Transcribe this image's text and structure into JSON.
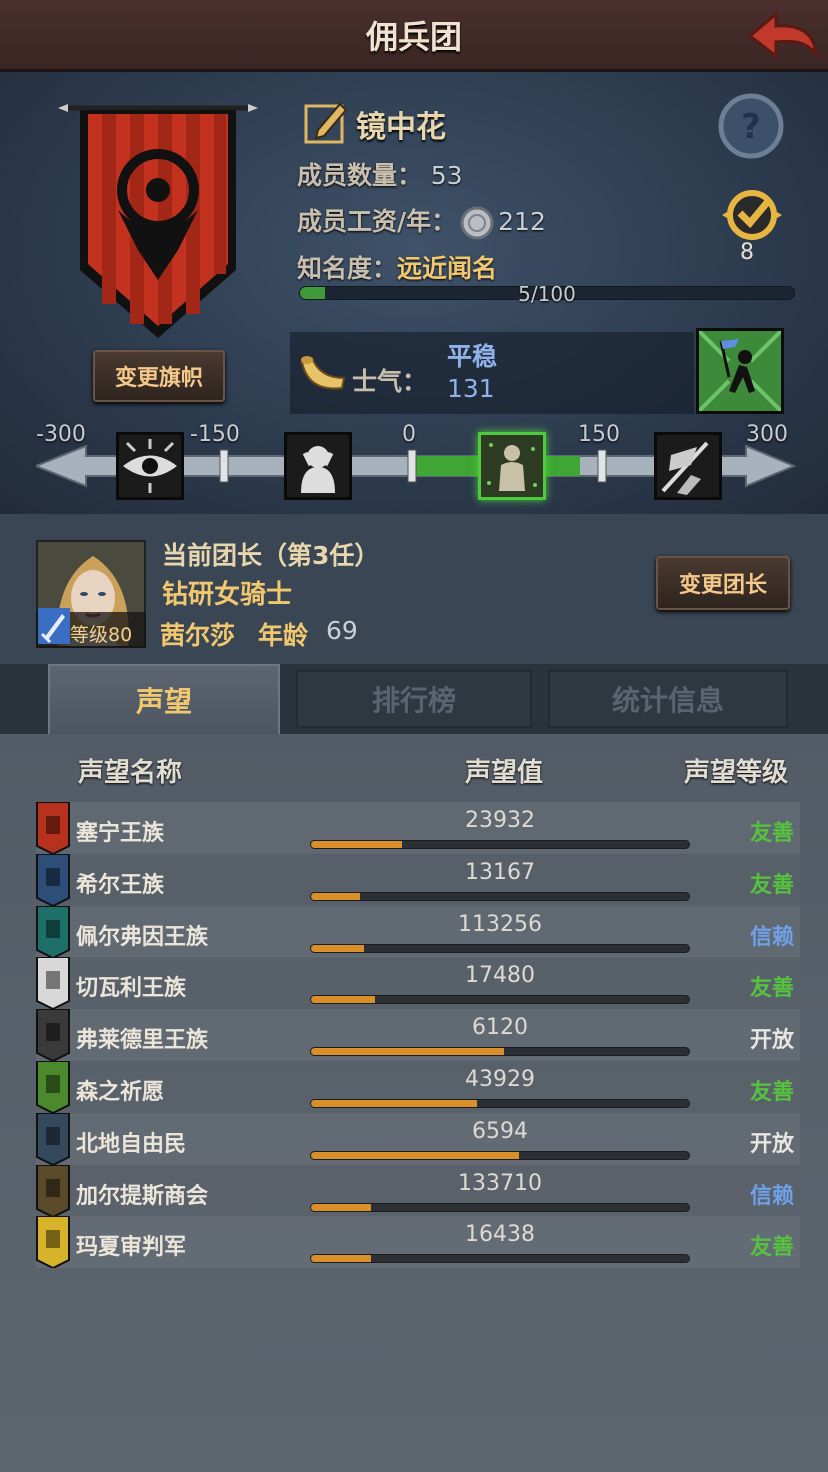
{
  "header": {
    "title": "佣兵团"
  },
  "guild": {
    "name": "镜中花",
    "members_label": "成员数量：",
    "members": "53",
    "salary_label": "成员工资/年：",
    "salary": "212",
    "fame_label": "知名度：",
    "fame_value": "远近闻名",
    "fame_progress_text": "5/100",
    "fame_progress": 0.05,
    "badge_count": "8",
    "change_flag_label": "变更旗帜"
  },
  "morale": {
    "label": "士气：",
    "status": "平稳",
    "value": "131",
    "track_ticks": [
      "-300",
      "-150",
      "0",
      "150",
      "300"
    ],
    "track_value": 131
  },
  "leader": {
    "title": "当前团长（第3任）",
    "class": "钻研女骑士",
    "name": "茜尔莎",
    "age_label": "年龄",
    "age": "69",
    "level": "等级80",
    "change_label": "变更团长"
  },
  "tabs": [
    {
      "label": "声望",
      "active": true
    },
    {
      "label": "排行榜",
      "active": false
    },
    {
      "label": "统计信息",
      "active": false
    }
  ],
  "reputation": {
    "columns": [
      "声望名称",
      "声望值",
      "声望等级"
    ],
    "rows": [
      {
        "name": "塞宁王族",
        "value": "23932",
        "level": "友善",
        "progress": 0.24,
        "icon_color": "#b8301e"
      },
      {
        "name": "希尔王族",
        "value": "13167",
        "level": "友善",
        "progress": 0.13,
        "icon_color": "#2c4e78"
      },
      {
        "name": "佩尔弗因王族",
        "value": "113256",
        "level": "信赖",
        "progress": 0.14,
        "icon_color": "#1d6f6a"
      },
      {
        "name": "切瓦利王族",
        "value": "17480",
        "level": "友善",
        "progress": 0.17,
        "icon_color": "#d8d8d8"
      },
      {
        "name": "弗莱德里王族",
        "value": "6120",
        "level": "开放",
        "progress": 0.51,
        "icon_color": "#3a3a3a"
      },
      {
        "name": "森之祈愿",
        "value": "43929",
        "level": "友善",
        "progress": 0.44,
        "icon_color": "#4b8a2c"
      },
      {
        "name": "北地自由民",
        "value": "6594",
        "level": "开放",
        "progress": 0.55,
        "icon_color": "#34495e"
      },
      {
        "name": "加尔提斯商会",
        "value": "133710",
        "level": "信赖",
        "progress": 0.16,
        "icon_color": "#5a4a2a"
      },
      {
        "name": "玛夏审判军",
        "value": "16438",
        "level": "友善",
        "progress": 0.16,
        "icon_color": "#d6b328"
      }
    ]
  }
}
